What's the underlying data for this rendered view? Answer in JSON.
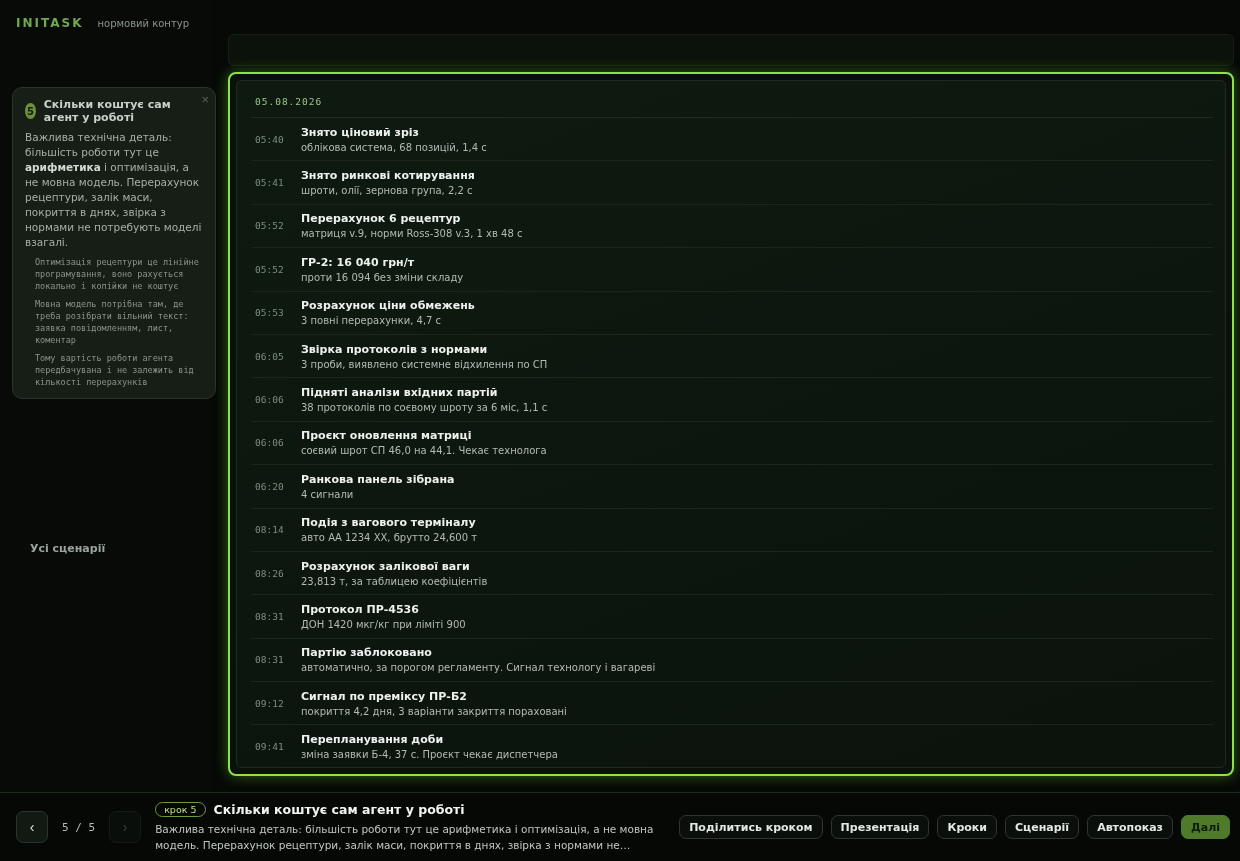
{
  "sidebar": {
    "logo": "INITASK",
    "subtitle": "нормовий контур",
    "items": [
      {
        "label": "Усі сценарії"
      }
    ]
  },
  "timeline": {
    "date": "05.08.2026",
    "events": [
      {
        "time": "05:40",
        "title": "Знято ціновий зріз",
        "detail": "облікова система, 68 позицій, 1,4 с"
      },
      {
        "time": "05:41",
        "title": "Знято ринкові котирування",
        "detail": "шроти, олії, зернова група, 2,2 с"
      },
      {
        "time": "05:52",
        "title": "Перерахунок 6 рецептур",
        "detail": "матриця v.9, норми Ross-308 v.3, 1 хв 48 с"
      },
      {
        "time": "05:52",
        "title": "ГР-2: 16 040 грн/т",
        "detail": "проти 16 094 без зміни складу"
      },
      {
        "time": "05:53",
        "title": "Розрахунок ціни обмежень",
        "detail": "3 повні перерахунки, 4,7 с"
      },
      {
        "time": "06:05",
        "title": "Звірка протоколів з нормами",
        "detail": "3 проби, виявлено системне відхилення по СП"
      },
      {
        "time": "06:06",
        "title": "Підняті аналізи вхідних партій",
        "detail": "38 протоколів по соєвому шроту за 6 міс, 1,1 с"
      },
      {
        "time": "06:06",
        "title": "Проєкт оновлення матриці",
        "detail": "соєвий шрот СП 46,0 на 44,1. Чекає технолога"
      },
      {
        "time": "06:20",
        "title": "Ранкова панель зібрана",
        "detail": "4 сигнали"
      },
      {
        "time": "08:14",
        "title": "Подія з вагового терміналу",
        "detail": "авто АА 1234 ХХ, брутто 24,600 т"
      },
      {
        "time": "08:26",
        "title": "Розрахунок залікової ваги",
        "detail": "23,813 т, за таблицею коефіцієнтів"
      },
      {
        "time": "08:31",
        "title": "Протокол ПР-4536",
        "detail": "ДОН 1420 мкг/кг при ліміті 900"
      },
      {
        "time": "08:31",
        "title": "Партію заблоковано",
        "detail": "автоматично, за порогом регламенту. Сигнал технологу і вагареві"
      },
      {
        "time": "09:12",
        "title": "Сигнал по преміксу ПР-Б2",
        "detail": "покриття 4,2 дня, 3 варіанти закриття пораховані"
      },
      {
        "time": "09:41",
        "title": "Перепланування доби",
        "detail": "зміна заявки Б-4, 37 с. Проєкт чекає диспетчера"
      }
    ]
  },
  "popover": {
    "step": "5",
    "title": "Скільки коштує сам агент у роботі",
    "close": "×",
    "text": "Важлива технічна деталь: більшість роботи тут це **арифметика** і оптимізація, а не мовна модель. Перерахунок рецептури, залік маси, покриття в днях, звірка з нормами не потребують моделі взагалі.",
    "notes": [
      "Оптимізація рецептури це лінійне програмування, воно рахується локально і копійки не коштує",
      "Мовна модель потрібна там, де треба розібрати вільний текст: заявка повідомленням, лист, коментар",
      "Тому вартість роботи агента передбачувана і не залежить від кількості перерахунків"
    ]
  },
  "footer": {
    "prev": "‹",
    "next": "›",
    "next_disabled": true,
    "position": "5 / 5",
    "badge": "крок 5",
    "title": "Скільки коштує сам агент у роботі",
    "text": "Важлива технічна деталь: більшість роботи тут це арифметика і оптимізація, а не мовна модель. Перерахунок рецептури, залік маси, покриття в днях, звірка з нормами не…",
    "buttons": [
      {
        "label": "Поділитись кроком",
        "kind": "outline"
      },
      {
        "label": "Презентація",
        "kind": "outline"
      },
      {
        "label": "Кроки",
        "kind": "outline"
      },
      {
        "label": "Сценарії",
        "kind": "outline"
      },
      {
        "label": "Автопоказ",
        "kind": "outline"
      },
      {
        "label": "Далі",
        "kind": "primary"
      }
    ]
  }
}
